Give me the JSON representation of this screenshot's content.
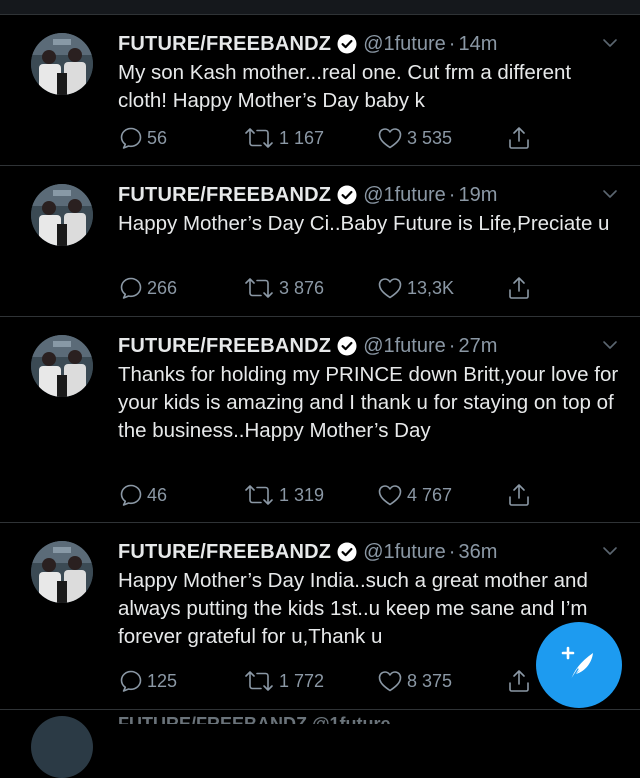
{
  "colors": {
    "background": "#000000",
    "text": "#e7e9ea",
    "secondary": "#8b98a5",
    "divider": "#2f3336",
    "verified": "#ffffff",
    "accent": "#1d9bf0"
  },
  "tweets": [
    {
      "name": "FUTURE/FREEBANDZ",
      "handle": "@1future",
      "separator": "·",
      "time": "14m",
      "text": "My son Kash mother...real one. Cut frm a different cloth! Happy Mother’s Day baby k",
      "replies": "56",
      "retweets": "1 167",
      "likes": "3 535"
    },
    {
      "name": "FUTURE/FREEBANDZ",
      "handle": "@1future",
      "separator": "·",
      "time": "19m",
      "text": "Happy Mother’s Day Ci..Baby Future is Life,Preciate u",
      "replies": "266",
      "retweets": "3 876",
      "likes": "13,3K"
    },
    {
      "name": "FUTURE/FREEBANDZ",
      "handle": "@1future",
      "separator": "·",
      "time": "27m",
      "text": "Thanks for holding my PRINCE down Britt,your love for your kids is amazing and I thank u for staying on top of the business..Happy Mother’s Day",
      "replies": "46",
      "retweets": "1 319",
      "likes": "4 767"
    },
    {
      "name": "FUTURE/FREEBANDZ",
      "handle": "@1future",
      "separator": "·",
      "time": "36m",
      "text": "Happy Mother’s Day India..such a great mother and always putting the kids 1st..u keep me sane and I’m forever grateful for u,Thank u",
      "replies": "125",
      "retweets": "1 772",
      "likes": "8 375"
    }
  ],
  "next_tweet_peek": "FUTURE/FREEBANDZ @1future",
  "fab": {
    "icon": "compose-tweet-icon"
  }
}
